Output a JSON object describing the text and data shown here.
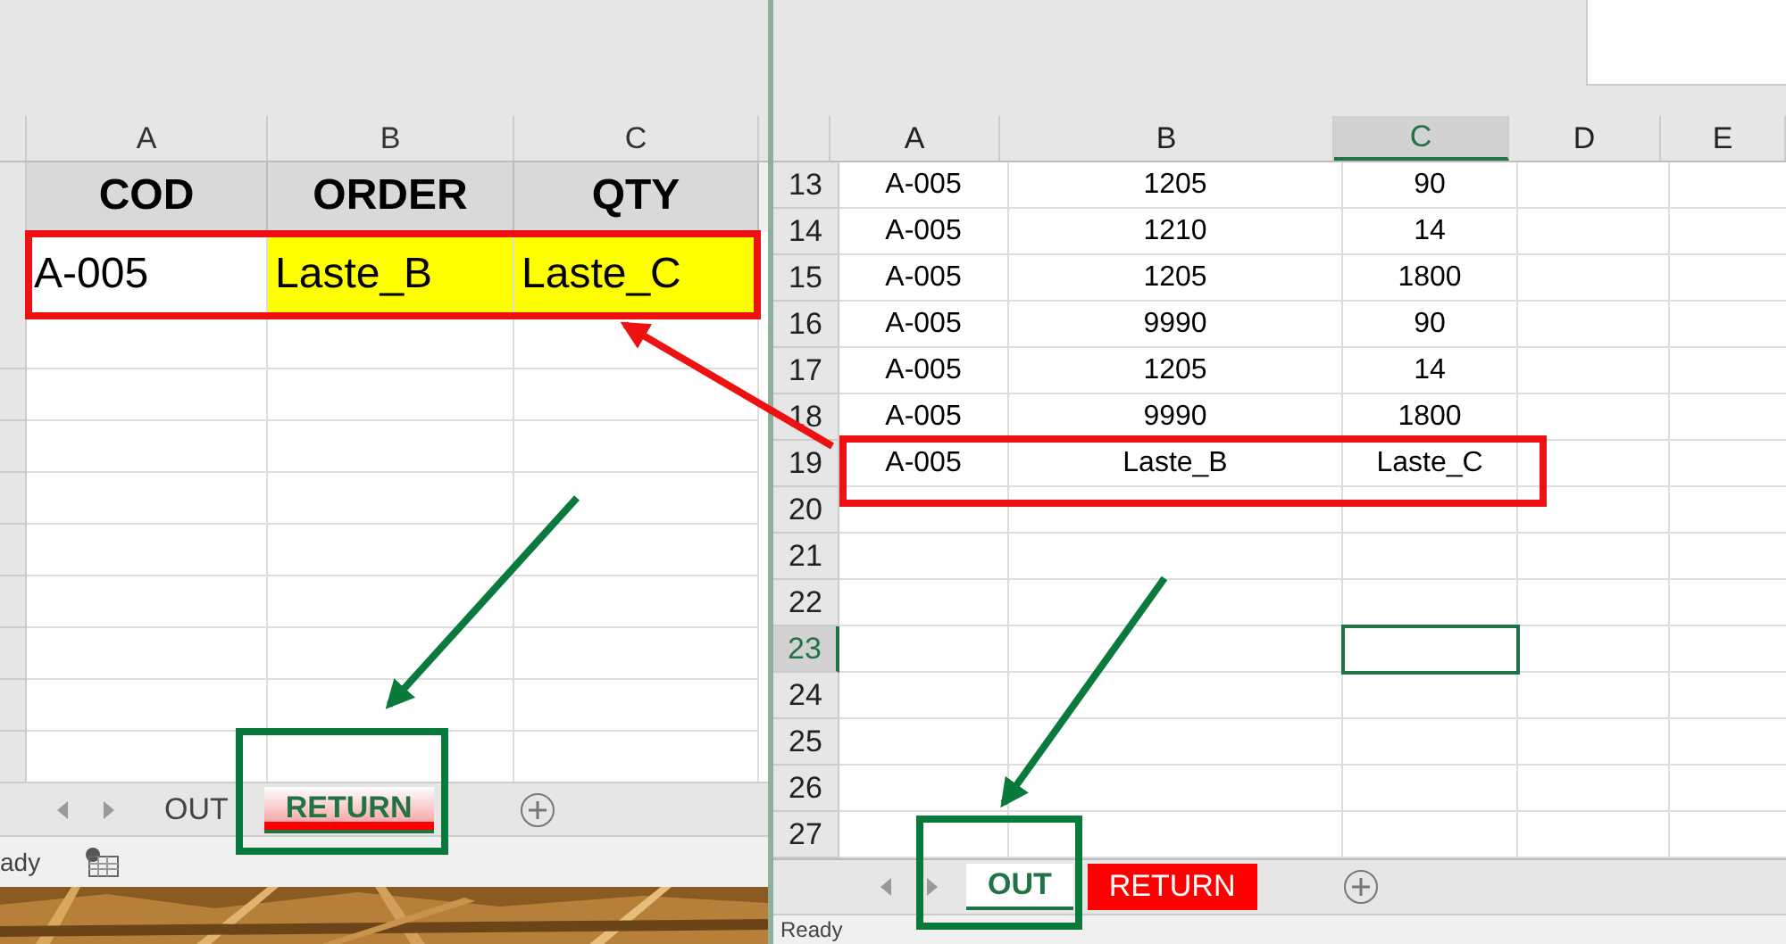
{
  "left_window": {
    "columns": [
      "A",
      "B",
      "C"
    ],
    "header_row": [
      "COD",
      "ORDER",
      "QTY"
    ],
    "data_row": [
      {
        "text": "A-005",
        "highlight": false
      },
      {
        "text": "Laste_B",
        "highlight": true
      },
      {
        "text": "Laste_C",
        "highlight": true
      }
    ],
    "sheet_tabs": [
      {
        "label": "OUT",
        "selected": false
      },
      {
        "label": "RETURN",
        "selected": true,
        "color": "#ff0000"
      }
    ],
    "status": "ady"
  },
  "right_window": {
    "columns": [
      {
        "label": "A",
        "selected": false
      },
      {
        "label": "B",
        "selected": false
      },
      {
        "label": "C",
        "selected": true
      },
      {
        "label": "D",
        "selected": false
      },
      {
        "label": "E",
        "selected": false
      }
    ],
    "rows": [
      {
        "number": "13",
        "selected": false,
        "cells": [
          "A-005",
          "1205",
          "90"
        ]
      },
      {
        "number": "14",
        "selected": false,
        "cells": [
          "A-005",
          "1210",
          "14"
        ]
      },
      {
        "number": "15",
        "selected": false,
        "cells": [
          "A-005",
          "1205",
          "1800"
        ]
      },
      {
        "number": "16",
        "selected": false,
        "cells": [
          "A-005",
          "9990",
          "90"
        ]
      },
      {
        "number": "17",
        "selected": false,
        "cells": [
          "A-005",
          "1205",
          "14"
        ]
      },
      {
        "number": "18",
        "selected": false,
        "cells": [
          "A-005",
          "9990",
          "1800"
        ]
      },
      {
        "number": "19",
        "selected": false,
        "cells": [
          "A-005",
          "Laste_B",
          "Laste_C"
        ]
      },
      {
        "number": "20",
        "selected": false
      },
      {
        "number": "21",
        "selected": false
      },
      {
        "number": "22",
        "selected": false
      },
      {
        "number": "23",
        "selected": true
      },
      {
        "number": "24",
        "selected": false
      },
      {
        "number": "25",
        "selected": false
      },
      {
        "number": "26",
        "selected": false
      },
      {
        "number": "27",
        "selected": false
      }
    ],
    "sheet_tabs": [
      {
        "label": "OUT",
        "selected": true
      },
      {
        "label": "RETURN",
        "selected": false,
        "color": "#ff0000"
      }
    ],
    "status": "Ready"
  }
}
